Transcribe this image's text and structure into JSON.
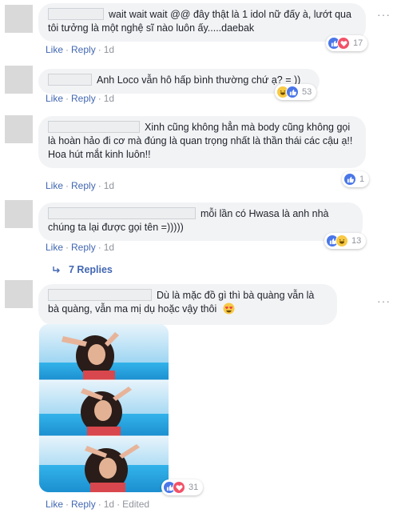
{
  "comments": [
    {
      "text": "wait wait wait @@ đây thật là 1 idol nữ đấy à, lướt qua tôi tưởng là một nghệ sĩ nào luôn ấy.....daebak",
      "actions": {
        "like": "Like",
        "reply": "Reply",
        "time": "1d"
      },
      "reactions": {
        "icons": [
          "like-icon",
          "love-icon"
        ],
        "count": "17"
      }
    },
    {
      "text": "Anh Loco vẫn hô hấp bình thường chứ ạ? = ))",
      "actions": {
        "like": "Like",
        "reply": "Reply",
        "time": "1d"
      },
      "reactions": {
        "icons": [
          "haha-icon",
          "like-icon"
        ],
        "count": "53"
      }
    },
    {
      "text": "Xinh cũng không hẳn mà body cũng không gọi là hoàn hảo đi cơ mà đúng là quan trọng nhất là thần thái các cậu ạ!!",
      "text2": "Hoa hút mắt kinh luôn!!",
      "actions": {
        "like": "Like",
        "reply": "Reply",
        "time": "1d"
      },
      "reactions": {
        "icons": [
          "like-icon"
        ],
        "count": "1"
      }
    },
    {
      "text": "mỗi lần có Hwasa là anh nhà chúng ta lại được gọi tên =)))))",
      "actions": {
        "like": "Like",
        "reply": "Reply",
        "time": "1d"
      },
      "reactions": {
        "icons": [
          "like-icon",
          "haha-icon"
        ],
        "count": "13"
      },
      "replies_label": "7 Replies"
    },
    {
      "text": "Dù là mặc đồ gì thì bà quàng vẫn là bà quàng, vẫn ma mị dụ hoặc vậy thôi",
      "emoji": "heart-eyes-icon",
      "actions": {
        "like": "Like",
        "reply": "Reply",
        "time": "1d",
        "edited": "Edited"
      },
      "reactions": {
        "icons": [
          "like-icon",
          "love-icon"
        ],
        "count": "31"
      }
    }
  ],
  "colors": {
    "link": "#4267b2",
    "bubble": "#f2f3f5",
    "like": "#4a76e8",
    "love": "#f25268",
    "haha": "#f7c944"
  }
}
